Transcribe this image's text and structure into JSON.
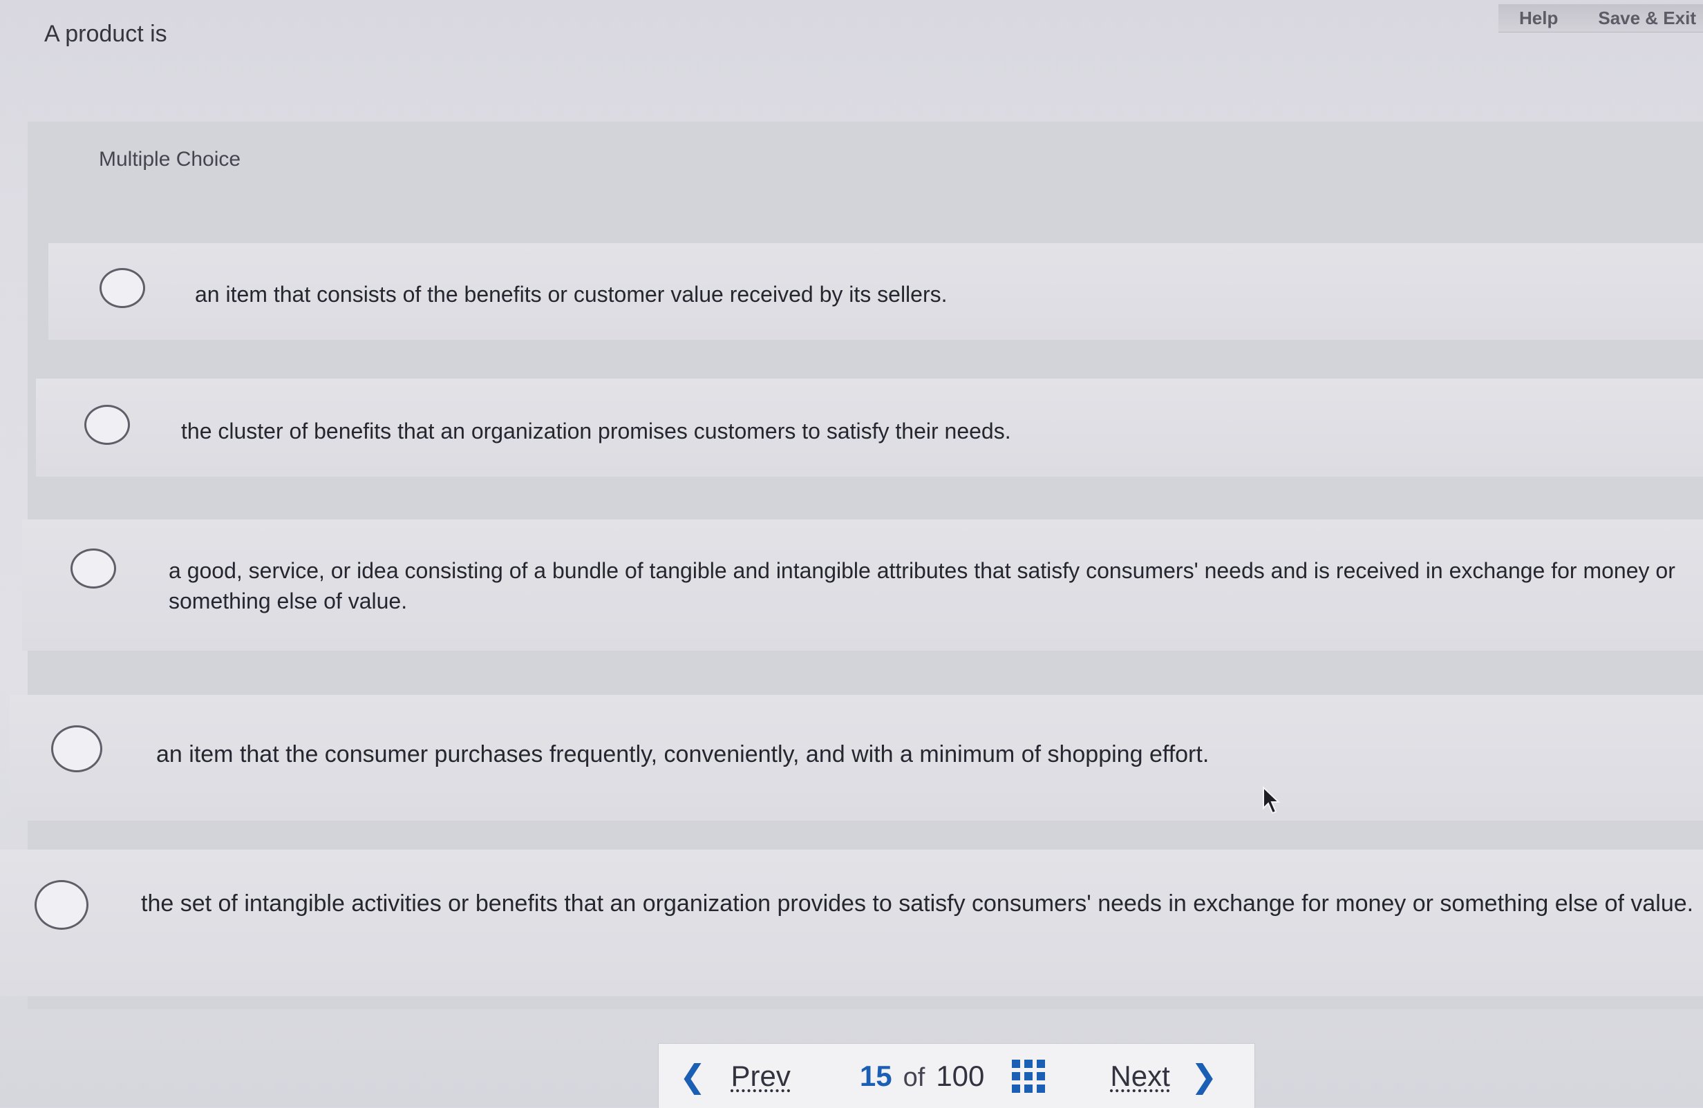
{
  "header": {
    "help_label": "Help",
    "save_exit_label": "Save & Exit"
  },
  "question": {
    "prompt": "A product is",
    "type_label": "Multiple Choice",
    "options": [
      {
        "text": "an item that consists of the benefits or customer value received by its sellers.",
        "selected": false
      },
      {
        "text": "the cluster of benefits that an organization promises customers to satisfy their needs.",
        "selected": false
      },
      {
        "text": "a good, service, or idea consisting of a bundle of tangible and intangible attributes that satisfy consumers' needs and is received in exchange for money or something else of value.",
        "selected": false
      },
      {
        "text": "an item that the consumer purchases frequently, conveniently, and with a minimum of shopping effort.",
        "selected": false
      },
      {
        "text": "the set of intangible activities or benefits that an organization provides to satisfy consumers' needs in exchange for money or something else of value.",
        "selected": false
      }
    ]
  },
  "navigation": {
    "prev_label": "Prev",
    "next_label": "Next",
    "current_page": "15",
    "of_label": "of",
    "total_pages": "100",
    "prev_icon": "chevron-left-icon",
    "next_icon": "chevron-right-icon",
    "grid_icon": "grid-icon"
  },
  "colors": {
    "accent": "#1a5fb4"
  }
}
